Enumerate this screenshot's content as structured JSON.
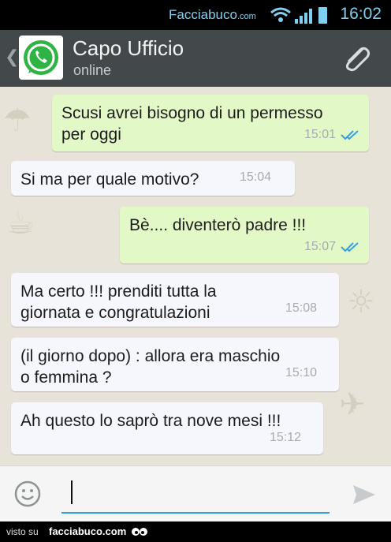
{
  "status_bar": {
    "brand": "Facciabuco",
    "brand_suffix": ".com",
    "time": "16:02"
  },
  "header": {
    "title": "Capo Ufficio",
    "subtitle": "online",
    "back_icon": "chevron-left-icon",
    "attach_icon": "paperclip-icon"
  },
  "messages": [
    {
      "dir": "out",
      "text_line1": "Scusi avrei bisogno di un permesso",
      "text_line2": "per oggi",
      "time": "15:01",
      "read": true
    },
    {
      "dir": "in",
      "text_line1": "Si ma per quale motivo?",
      "time": "15:04"
    },
    {
      "dir": "out",
      "text_line1": "Bè.... diventerò padre !!!",
      "time": "15:07",
      "read": true
    },
    {
      "dir": "in",
      "text_line1": "Ma certo !!! prenditi tutta la",
      "text_line2": "giornata e congratulazioni",
      "time": "15:08"
    },
    {
      "dir": "in",
      "text_line1": "(il giorno dopo) : allora era maschio",
      "text_line2": "o femmina ?",
      "time": "15:10"
    },
    {
      "dir": "in",
      "text_line1": "Ah questo lo saprò tra nove mesi !!!",
      "time": "15:12"
    }
  ],
  "composer": {
    "emoji_icon": "smiley-icon",
    "send_icon": "send-icon",
    "value": ""
  },
  "footer": {
    "visto": "visto su",
    "site": "facciabuco.com"
  },
  "colors": {
    "header": "#43484b",
    "out_bubble": "#e3f8c7",
    "in_bubble": "#f6f7fd",
    "tick_blue": "#3aa0dc",
    "accent": "#2aa5d8"
  }
}
